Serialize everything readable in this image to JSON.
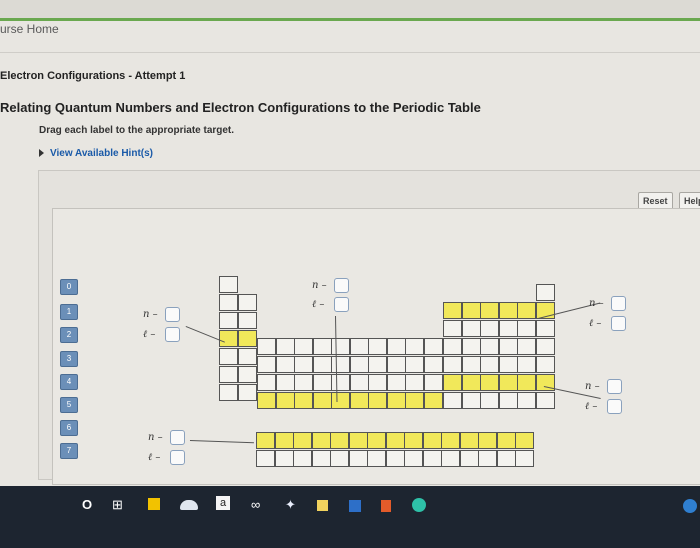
{
  "breadcrumb": "urse Home",
  "assignment": "Electron Configurations - Attempt 1",
  "title": "Relating Quantum Numbers and Electron Configurations to the Periodic Table",
  "instruction": "Drag each label to the appropriate target.",
  "hint": "View Available Hint(s)",
  "buttons": {
    "reset": "Reset",
    "help": "Help"
  },
  "periods": [
    "0",
    "1",
    "2",
    "3",
    "4",
    "5",
    "6",
    "7"
  ],
  "labels": {
    "n": "n –",
    "l": "ℓ –"
  },
  "taskbar": {
    "search": "O",
    "taskview": "⊞",
    "a": "a",
    "infinity": "∞",
    "dropbox": "✦"
  }
}
